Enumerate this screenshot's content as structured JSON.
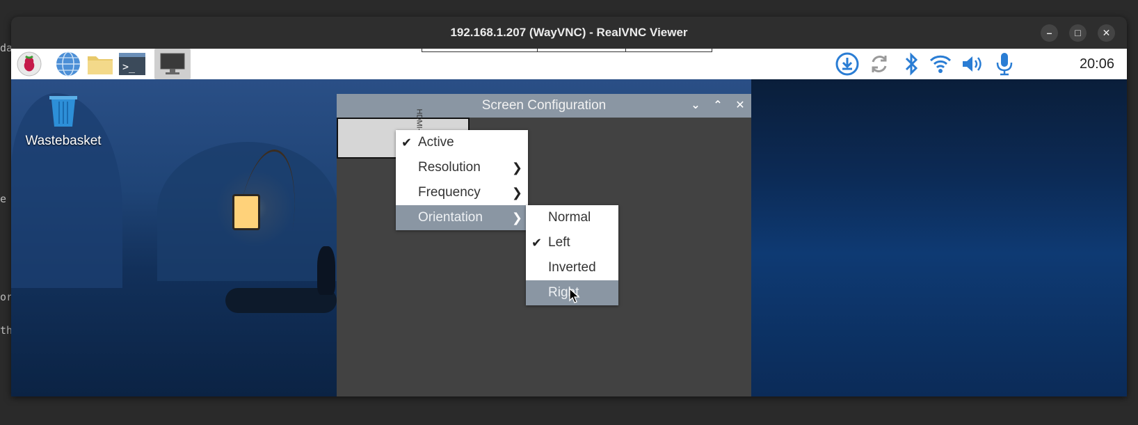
{
  "background_text": [
    "da",
    "e",
    "or",
    "th"
  ],
  "vnc": {
    "title": "192.168.1.207 (WayVNC) - RealVNC Viewer",
    "minimize_icon": "minimize-icon",
    "maximize_icon": "maximize-icon",
    "close_icon": "close-icon"
  },
  "taskbar": {
    "launchers": [
      "raspberry-menu-icon",
      "web-browser-icon",
      "file-manager-icon",
      "terminal-icon",
      "screen-configuration-icon"
    ],
    "tray": [
      "download-update-icon",
      "sync-icon",
      "bluetooth-icon",
      "wifi-icon",
      "volume-icon",
      "microphone-icon"
    ],
    "clock": "20:06"
  },
  "desktop": {
    "icon_label": "Wastebasket"
  },
  "screen_config": {
    "title": "Screen Configuration",
    "monitor_label": "HDMI-A-1"
  },
  "context_menu": {
    "items": [
      {
        "label": "Active",
        "checked": true,
        "submenu": false
      },
      {
        "label": "Resolution",
        "checked": false,
        "submenu": true
      },
      {
        "label": "Frequency",
        "checked": false,
        "submenu": true
      },
      {
        "label": "Orientation",
        "checked": false,
        "submenu": true,
        "highlighted": true
      }
    ]
  },
  "orientation_menu": {
    "items": [
      {
        "label": "Normal",
        "checked": false
      },
      {
        "label": "Left",
        "checked": true
      },
      {
        "label": "Inverted",
        "checked": false
      },
      {
        "label": "Right",
        "checked": false,
        "highlighted": true
      }
    ]
  },
  "colors": {
    "accent": "#8a96a3",
    "window_bg": "#424242",
    "taskbar": "#ffffff"
  }
}
